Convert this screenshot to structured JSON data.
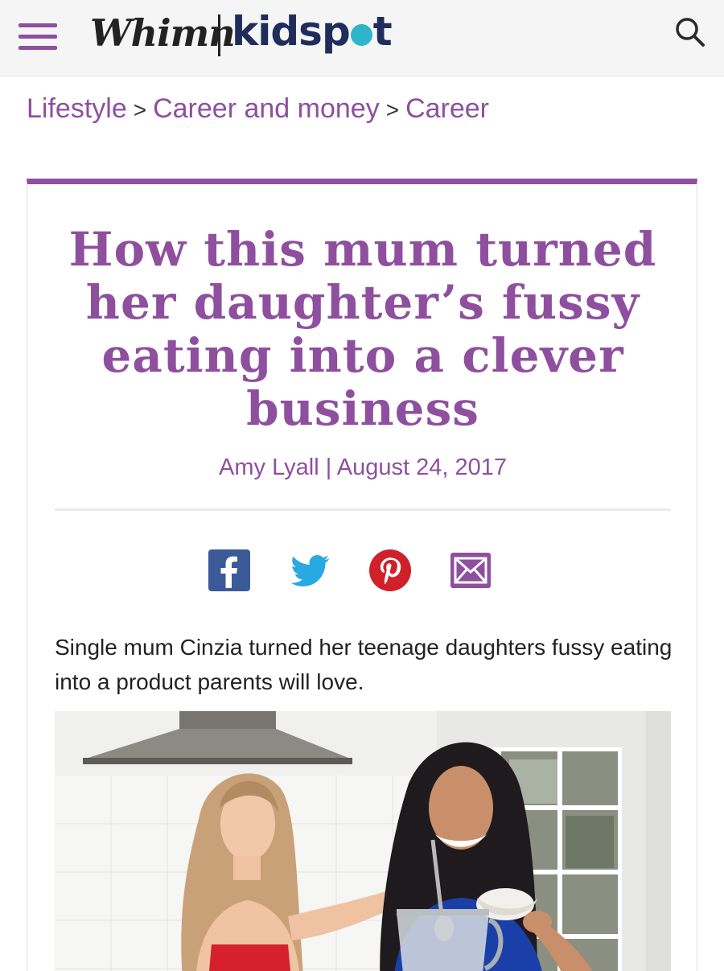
{
  "header": {
    "menu_icon": "hamburger-menu-icon",
    "logo_left": "Whimn",
    "logo_right_prefix": "kidsp",
    "logo_right_suffix": "t",
    "search_icon": "search-icon",
    "accent_color": "#8e4f9e"
  },
  "breadcrumb": {
    "items": [
      "Lifestyle",
      "Career and money",
      "Career"
    ],
    "separator": ">"
  },
  "article": {
    "title": "How this mum turned her daughter’s fussy eating into a clever business",
    "author": "Amy Lyall",
    "byline_separator": "|",
    "date": "August 24, 2017",
    "share": {
      "facebook": "facebook-icon",
      "twitter": "twitter-icon",
      "pinterest": "pinterest-icon",
      "email": "email-icon"
    },
    "lede": "Single mum Cinzia turned her teenage daughters fussy eating into a product parents will love.",
    "image": "photo-mother-and-daughter-cooking"
  }
}
